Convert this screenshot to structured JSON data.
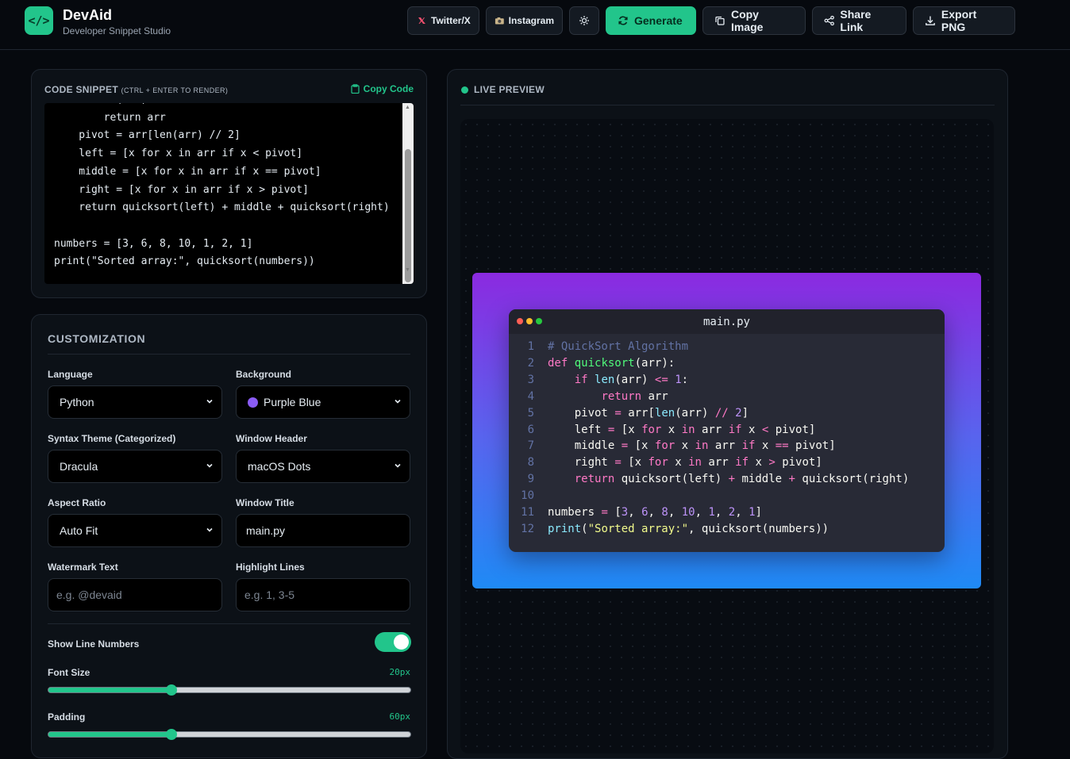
{
  "app": {
    "name": "DevAid",
    "tagline": "Developer Snippet Studio",
    "logo_text": "</>"
  },
  "header": {
    "buttons": {
      "twitter": "Twitter/X",
      "instagram": "Instagram",
      "generate": "Generate",
      "copy_image": "Copy Image",
      "share_link": "Share Link",
      "export_png": "Export PNG"
    }
  },
  "code_panel": {
    "title": "CODE SNIPPET",
    "hint": "(CTRL + ENTER TO RENDER)",
    "copy_label": "Copy Code",
    "source": "    if len(arr) <= 1:\n        return arr\n    pivot = arr[len(arr) // 2]\n    left = [x for x in arr if x < pivot]\n    middle = [x for x in arr if x == pivot]\n    right = [x for x in arr if x > pivot]\n    return quicksort(left) + middle + quicksort(right)\n\nnumbers = [3, 6, 8, 10, 1, 2, 1]\nprint(\"Sorted array:\", quicksort(numbers))"
  },
  "customization": {
    "title": "CUSTOMIZATION",
    "language": {
      "label": "Language",
      "value": "Python"
    },
    "background": {
      "label": "Background",
      "value": "Purple Blue",
      "swatch": "#8b5cf6"
    },
    "syntax_theme": {
      "label": "Syntax Theme (Categorized)",
      "value": "Dracula"
    },
    "window_header": {
      "label": "Window Header",
      "value": "macOS Dots"
    },
    "aspect_ratio": {
      "label": "Aspect Ratio",
      "value": "Auto Fit"
    },
    "window_title": {
      "label": "Window Title",
      "value": "main.py"
    },
    "watermark": {
      "label": "Watermark Text",
      "placeholder": "e.g. @devaid"
    },
    "highlight": {
      "label": "Highlight Lines",
      "placeholder": "e.g. 1, 3-5"
    },
    "line_numbers": {
      "label": "Show Line Numbers",
      "enabled": true
    },
    "font_size": {
      "label": "Font Size",
      "value_text": "20px",
      "fraction": 0.34
    },
    "padding": {
      "label": "Padding",
      "value_text": "60px",
      "fraction": 0.34
    }
  },
  "preview": {
    "title": "LIVE PREVIEW",
    "window_title": "main.py",
    "gradient": [
      "#8b2ae0",
      "#1f8af5"
    ],
    "lines": [
      "# QuickSort Algorithm",
      "def quicksort(arr):",
      "    if len(arr) <= 1:",
      "        return arr",
      "    pivot = arr[len(arr) // 2]",
      "    left = [x for x in arr if x < pivot]",
      "    middle = [x for x in arr if x == pivot]",
      "    right = [x for x in arr if x > pivot]",
      "    return quicksort(left) + middle + quicksort(right)",
      "",
      "numbers = [3, 6, 8, 10, 1, 2, 1]",
      "print(\"Sorted array:\", quicksort(numbers))"
    ]
  }
}
